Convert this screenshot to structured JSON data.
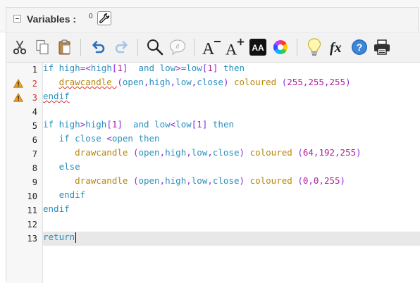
{
  "variables": {
    "label": "Variables :",
    "count": "0"
  },
  "toolbar": {
    "buttons": [
      "cut",
      "copy",
      "paste",
      "undo",
      "redo",
      "find",
      "comment",
      "font-decrease",
      "font-increase",
      "dark-theme",
      "color-picker",
      "tip",
      "functions",
      "help",
      "print"
    ],
    "font_decrease_glyph": "A",
    "font_increase_glyph": "A",
    "theme_glyph": "AA",
    "fx_glyph": "fx",
    "help_glyph": "?",
    "comment_glyph": "//"
  },
  "editor": {
    "line_numbers": [
      "1",
      "2",
      "3",
      "4",
      "5",
      "6",
      "7",
      "8",
      "9",
      "10",
      "11",
      "12",
      "13"
    ],
    "warning_lines": [
      "2",
      "3"
    ],
    "code": [
      [
        {
          "t": "if ",
          "c": "kw"
        },
        {
          "t": "high",
          "c": "kw"
        },
        {
          "t": "=<",
          "c": "pl"
        },
        {
          "t": "high",
          "c": "kw"
        },
        {
          "t": "[",
          "c": "pl"
        },
        {
          "t": "1",
          "c": "num"
        },
        {
          "t": "]  ",
          "c": "pl"
        },
        {
          "t": "and ",
          "c": "kw"
        },
        {
          "t": "low",
          "c": "kw"
        },
        {
          "t": ">=",
          "c": "pl"
        },
        {
          "t": "low",
          "c": "kw"
        },
        {
          "t": "[",
          "c": "pl"
        },
        {
          "t": "1",
          "c": "num"
        },
        {
          "t": "] ",
          "c": "pl"
        },
        {
          "t": "then",
          "c": "kw"
        }
      ],
      [
        {
          "t": "   ",
          "c": ""
        },
        {
          "t": "drawcandle ",
          "c": "fn err"
        },
        {
          "t": "(",
          "c": "pl"
        },
        {
          "t": "open",
          "c": "kw"
        },
        {
          "t": ",",
          "c": "pl"
        },
        {
          "t": "high",
          "c": "kw"
        },
        {
          "t": ",",
          "c": "pl"
        },
        {
          "t": "low",
          "c": "kw"
        },
        {
          "t": ",",
          "c": "pl"
        },
        {
          "t": "close",
          "c": "kw"
        },
        {
          "t": ") ",
          "c": "pl"
        },
        {
          "t": "coloured ",
          "c": "fn"
        },
        {
          "t": "(",
          "c": "pl"
        },
        {
          "t": "255",
          "c": "num"
        },
        {
          "t": ",",
          "c": "pl"
        },
        {
          "t": "255",
          "c": "num"
        },
        {
          "t": ",",
          "c": "pl"
        },
        {
          "t": "255",
          "c": "num"
        },
        {
          "t": ")",
          "c": "pl"
        }
      ],
      [
        {
          "t": "endif",
          "c": "kw err"
        }
      ],
      [],
      [
        {
          "t": "if ",
          "c": "kw"
        },
        {
          "t": "high",
          "c": "kw"
        },
        {
          "t": ">",
          "c": "pl"
        },
        {
          "t": "high",
          "c": "kw"
        },
        {
          "t": "[",
          "c": "pl"
        },
        {
          "t": "1",
          "c": "num"
        },
        {
          "t": "]  ",
          "c": "pl"
        },
        {
          "t": "and ",
          "c": "kw"
        },
        {
          "t": "low",
          "c": "kw"
        },
        {
          "t": "<",
          "c": "pl"
        },
        {
          "t": "low",
          "c": "kw"
        },
        {
          "t": "[",
          "c": "pl"
        },
        {
          "t": "1",
          "c": "num"
        },
        {
          "t": "] ",
          "c": "pl"
        },
        {
          "t": "then",
          "c": "kw"
        }
      ],
      [
        {
          "t": "   ",
          "c": ""
        },
        {
          "t": "if ",
          "c": "kw"
        },
        {
          "t": "close ",
          "c": "kw"
        },
        {
          "t": "<",
          "c": "pl"
        },
        {
          "t": "open ",
          "c": "kw"
        },
        {
          "t": "then",
          "c": "kw"
        }
      ],
      [
        {
          "t": "      ",
          "c": ""
        },
        {
          "t": "drawcandle ",
          "c": "fn"
        },
        {
          "t": "(",
          "c": "pl"
        },
        {
          "t": "open",
          "c": "kw"
        },
        {
          "t": ",",
          "c": "pl"
        },
        {
          "t": "high",
          "c": "kw"
        },
        {
          "t": ",",
          "c": "pl"
        },
        {
          "t": "low",
          "c": "kw"
        },
        {
          "t": ",",
          "c": "pl"
        },
        {
          "t": "close",
          "c": "kw"
        },
        {
          "t": ") ",
          "c": "pl"
        },
        {
          "t": "coloured ",
          "c": "fn"
        },
        {
          "t": "(",
          "c": "pl"
        },
        {
          "t": "64",
          "c": "num"
        },
        {
          "t": ",",
          "c": "pl"
        },
        {
          "t": "192",
          "c": "num"
        },
        {
          "t": ",",
          "c": "pl"
        },
        {
          "t": "255",
          "c": "num"
        },
        {
          "t": ")",
          "c": "pl"
        }
      ],
      [
        {
          "t": "   ",
          "c": ""
        },
        {
          "t": "else",
          "c": "kw"
        }
      ],
      [
        {
          "t": "      ",
          "c": ""
        },
        {
          "t": "drawcandle ",
          "c": "fn"
        },
        {
          "t": "(",
          "c": "pl"
        },
        {
          "t": "open",
          "c": "kw"
        },
        {
          "t": ",",
          "c": "pl"
        },
        {
          "t": "high",
          "c": "kw"
        },
        {
          "t": ",",
          "c": "pl"
        },
        {
          "t": "low",
          "c": "kw"
        },
        {
          "t": ",",
          "c": "pl"
        },
        {
          "t": "close",
          "c": "kw"
        },
        {
          "t": ") ",
          "c": "pl"
        },
        {
          "t": "coloured ",
          "c": "fn"
        },
        {
          "t": "(",
          "c": "pl"
        },
        {
          "t": "0",
          "c": "num"
        },
        {
          "t": ",",
          "c": "pl"
        },
        {
          "t": "0",
          "c": "num"
        },
        {
          "t": ",",
          "c": "pl"
        },
        {
          "t": "255",
          "c": "num"
        },
        {
          "t": ")",
          "c": "pl"
        }
      ],
      [
        {
          "t": "   ",
          "c": ""
        },
        {
          "t": "endif",
          "c": "kw"
        }
      ],
      [
        {
          "t": "endif",
          "c": "kw"
        }
      ],
      [],
      [
        {
          "t": "return",
          "c": "kw"
        }
      ]
    ],
    "active_line": "13",
    "colors": {
      "keyword": "#2a8fbf",
      "function": "#b8860b",
      "operator": "#8a2be2",
      "number": "#b0209a",
      "error_underline": "#e03030"
    }
  }
}
